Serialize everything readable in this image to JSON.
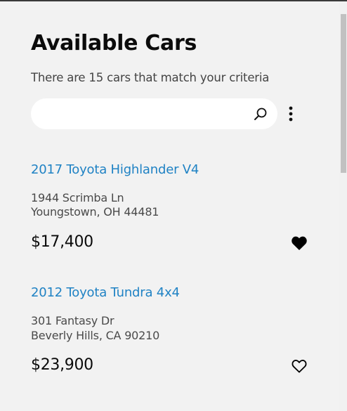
{
  "header": {
    "title": "Available Cars",
    "subtitle": "There are 15 cars that match your criteria"
  },
  "search": {
    "value": "",
    "placeholder": ""
  },
  "icons": {
    "search": "search-icon",
    "more": "more-vertical-icon",
    "favorite_filled": "heart-filled-icon",
    "favorite_outline": "heart-outline-icon"
  },
  "cars": [
    {
      "title": "2017 Toyota Highlander V4",
      "address_line1": "1944 Scrimba Ln",
      "address_line2": "Youngstown, OH 44481",
      "price": "$17,400",
      "favorited": true
    },
    {
      "title": "2012 Toyota Tundra 4x4",
      "address_line1": "301 Fantasy Dr",
      "address_line2": "Beverly Hills, CA 90210",
      "price": "$23,900",
      "favorited": false
    }
  ],
  "colors": {
    "link": "#1f82c4",
    "background": "#f2f2f2",
    "text": "#0b0b0b"
  }
}
